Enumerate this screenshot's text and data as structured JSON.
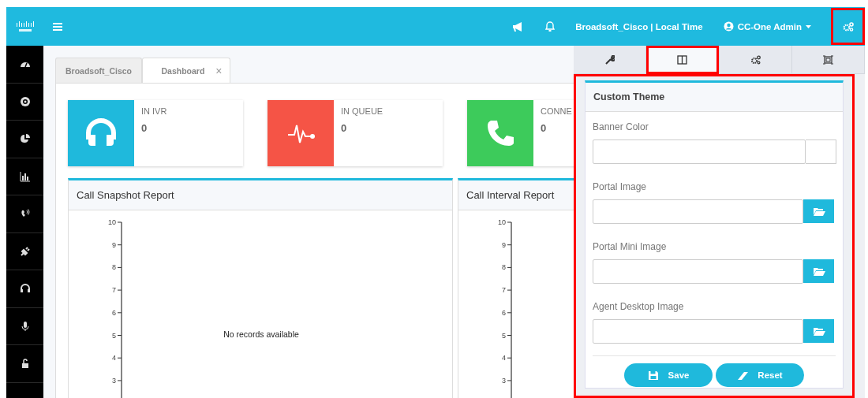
{
  "header": {
    "location": "Broadsoft_Cisco | Local Time",
    "user": "CC-One Admin",
    "settings_highlighted": true
  },
  "tabs": [
    {
      "label": "Broadsoft_Cisco",
      "selected": false
    },
    {
      "label": "Dashboard",
      "selected": true,
      "close": "×"
    }
  ],
  "stats": [
    {
      "label": "IN IVR",
      "value": "0",
      "color": "#1fb9dc"
    },
    {
      "label": "IN QUEUE",
      "value": "0",
      "color": "#f55446"
    },
    {
      "label": "CONNE",
      "value": "0",
      "color": "#3dcb5b"
    }
  ],
  "reports": [
    {
      "title": "Call Snapshot Report",
      "ticks": [
        "10",
        "9",
        "8",
        "7",
        "6",
        "5",
        "4",
        "3"
      ],
      "message": "No records available"
    },
    {
      "title": "Call Interval Report",
      "ticks": [
        "10",
        "9",
        "8",
        "7",
        "6",
        "5",
        "4",
        "3"
      ]
    }
  ],
  "settings_panel": {
    "highlighted": true,
    "tabs": [
      {
        "selected": false,
        "highlighted": false
      },
      {
        "selected": true,
        "highlighted": true
      },
      {
        "selected": false,
        "highlighted": false
      },
      {
        "selected": false,
        "highlighted": false
      }
    ],
    "custom_theme": {
      "title": "Custom Theme",
      "fields": [
        {
          "label": "Banner Color",
          "kind": "color"
        },
        {
          "label": "Portal Image",
          "kind": "file"
        },
        {
          "label": "Portal Mini Image",
          "kind": "file"
        },
        {
          "label": "Agent Desktop Image",
          "kind": "file"
        }
      ],
      "buttons": [
        {
          "label": "Save"
        },
        {
          "label": "Reset"
        }
      ]
    }
  }
}
